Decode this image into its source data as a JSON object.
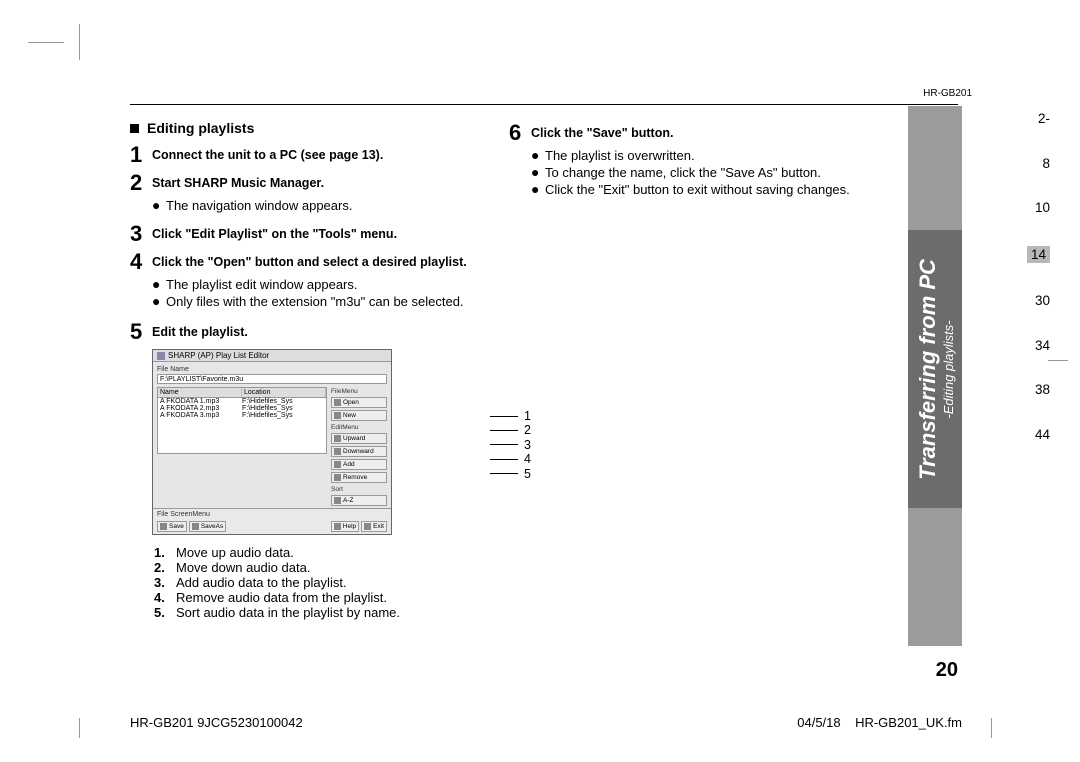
{
  "header": {
    "model": "HR-GB201"
  },
  "section": {
    "title": "Editing playlists"
  },
  "steps": {
    "s1": "Connect the unit to a PC (see page 13).",
    "s2": "Start SHARP Music Manager.",
    "s2_sub1": "The navigation window appears.",
    "s3": "Click \"Edit Playlist\" on the \"Tools\" menu.",
    "s4": "Click the \"Open\" button and select a desired playlist.",
    "s4_sub1": "The playlist edit window appears.",
    "s4_sub2": "Only files with the extension \"m3u\" can be selected.",
    "s5": "Edit the playlist.",
    "s6": "Click the \"Save\" button.",
    "s6_sub1": "The playlist is overwritten.",
    "s6_sub2": "To change the name, click the \"Save As\" button.",
    "s6_sub3": "Click the \"Exit\" button to exit without saving changes."
  },
  "legend": {
    "l1": "Move up audio data.",
    "l2": "Move down audio data.",
    "l3": "Add audio data to the playlist.",
    "l4": "Remove audio data from the playlist.",
    "l5": "Sort audio data in the playlist by name."
  },
  "editor": {
    "window_title": "SHARP (AP) Play List Editor",
    "file_name_label": "File Name",
    "file_name_value": "F:\\PLAYLIST\\Favorite.m3u",
    "col_name": "Name",
    "col_location": "Location",
    "rows": [
      {
        "name": "A FKODATA 1.mp3",
        "loc": "F:\\Hidefiles_Sys"
      },
      {
        "name": "A FKODATA 2.mp3",
        "loc": "F:\\Hidefiles_Sys"
      },
      {
        "name": "A FKODATA 3.mp3",
        "loc": "F:\\Hidefiles_Sys"
      }
    ],
    "side": {
      "filemenu": "FileMenu",
      "open": "Open",
      "new": "New",
      "editmenu": "EditMenu",
      "upward": "Upward",
      "downward": "Downward",
      "add": "Add",
      "remove": "Remove",
      "sort": "Sort",
      "az": "A-Z"
    },
    "footer": {
      "screen_label": "File ScreenMenu",
      "save": "Save",
      "saveas": "SaveAs",
      "help": "Help",
      "exit": "Exit"
    }
  },
  "callouts": {
    "c1": "1",
    "c2": "2",
    "c3": "3",
    "c4": "4",
    "c5": "5"
  },
  "sidetab": {
    "main": "Transferring from PC",
    "sub": "-Editing playlists-"
  },
  "index": {
    "p0": "2-",
    "p1": "8",
    "p2": "10",
    "p3": "14",
    "p4": "30",
    "p5": "34",
    "p6": "38",
    "p7": "44"
  },
  "page_number": "20",
  "footer": {
    "left": "HR-GB201 9JCG5230100042",
    "right_date": "04/5/18",
    "right_file": "HR-GB201_UK.fm"
  }
}
